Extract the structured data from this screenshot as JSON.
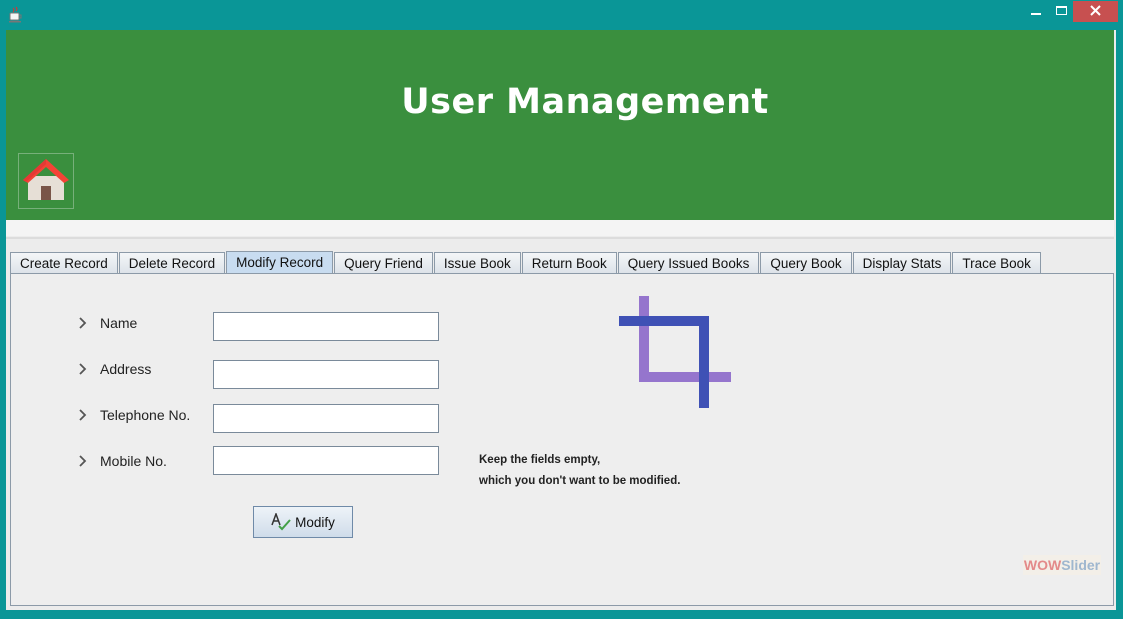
{
  "window": {
    "app_icon": "java-cup-icon",
    "controls": [
      "minimize-icon",
      "maximize-icon",
      "close-icon"
    ]
  },
  "header": {
    "title": "User Management",
    "home_icon": "home-icon"
  },
  "tabs": [
    {
      "label": "Create Record",
      "selected": false
    },
    {
      "label": "Delete Record",
      "selected": false
    },
    {
      "label": "Modify Record",
      "selected": true
    },
    {
      "label": "Query Friend",
      "selected": false
    },
    {
      "label": "Issue Book",
      "selected": false
    },
    {
      "label": "Return Book",
      "selected": false
    },
    {
      "label": "Query Issued Books",
      "selected": false
    },
    {
      "label": "Query Book",
      "selected": false
    },
    {
      "label": "Display Stats",
      "selected": false
    },
    {
      "label": "Trace Book",
      "selected": false
    }
  ],
  "form": {
    "fields": [
      {
        "label": "Name",
        "value": ""
      },
      {
        "label": "Address",
        "value": ""
      },
      {
        "label": "Telephone No.",
        "value": ""
      },
      {
        "label": "Mobile No.",
        "value": ""
      }
    ],
    "note_line1": "Keep the fields empty,",
    "note_line2": "which you don't want to be modified.",
    "modify_label": "Modify",
    "modify_icon": "spellcheck-icon",
    "illustration_icon": "crop-icon"
  },
  "watermark": {
    "part1": "WOW",
    "part2": "Slider"
  },
  "colors": {
    "titlebar": "#0a9697",
    "banner": "#3a8f3e",
    "close_button": "#c75050",
    "selected_tab": "#c8dcf0",
    "crop_dark": "#3f51b5",
    "crop_light": "#9575cd"
  }
}
